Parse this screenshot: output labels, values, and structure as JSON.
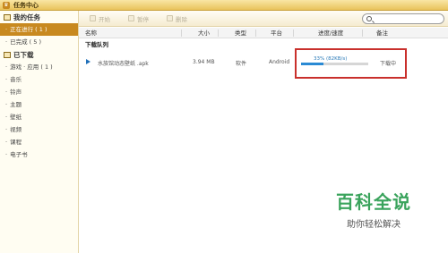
{
  "window": {
    "title": "任务中心",
    "icon_glyph": "♛"
  },
  "sidebar": {
    "my_tasks": {
      "label": "我的任务",
      "items": [
        {
          "label": "正在进行 ( 1 )",
          "active": true
        },
        {
          "label": "已完成 ( 5 )",
          "active": false
        }
      ]
    },
    "downloaded": {
      "label": "已下载",
      "items": [
        {
          "label": "游戏 · 应用 ( 1 )"
        },
        {
          "label": "音乐"
        },
        {
          "label": "铃声"
        },
        {
          "label": "主题"
        },
        {
          "label": "壁纸"
        },
        {
          "label": "视频"
        },
        {
          "label": "课程"
        },
        {
          "label": "电子书"
        }
      ]
    }
  },
  "toolbar": {
    "start_label": "开始",
    "pause_label": "暂停",
    "delete_label": "删除"
  },
  "table": {
    "columns": [
      "名称",
      "大小",
      "类型",
      "平台",
      "进度/速度",
      "备注"
    ],
    "group_label": "下载队列",
    "rows": [
      {
        "name": "水族馆动态壁纸 .apk",
        "size": "3.94 MB",
        "type": "软件",
        "platform": "Android",
        "progress_text": "33%  (82KB/s)",
        "progress_percent": 33,
        "note": "下载中"
      }
    ]
  },
  "watermark": {
    "title": "百科全说",
    "subtitle": "助你轻松解决"
  },
  "colors": {
    "accent": "#c8891f",
    "highlight_box": "#c9302c",
    "progress": "#2a8ad4",
    "watermark": "#3aa35c"
  }
}
